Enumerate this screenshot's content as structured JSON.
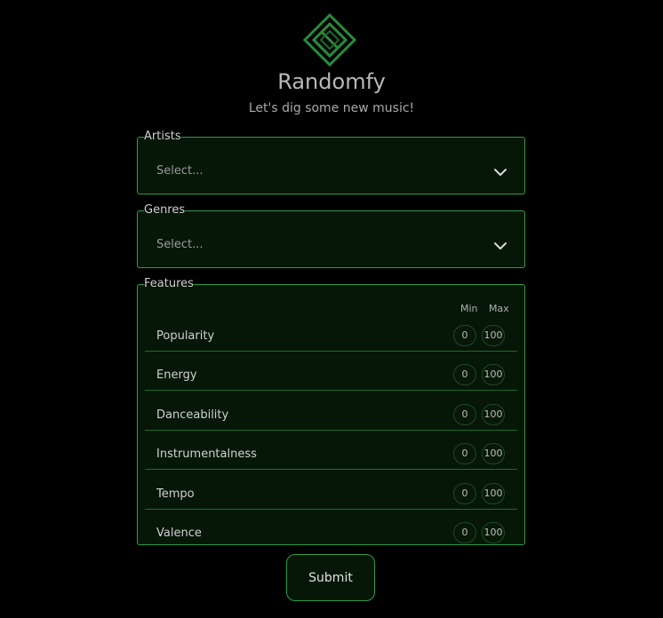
{
  "app": {
    "title": "Randomfy",
    "subtitle": "Let's dig some new music!",
    "logo_icon": "diamond-logo-icon",
    "accent_color": "#2f9a44"
  },
  "artists": {
    "legend": "Artists",
    "placeholder": "Select...",
    "icon": "chevron-down-icon"
  },
  "genres": {
    "legend": "Genres",
    "placeholder": "Select...",
    "icon": "chevron-down-icon"
  },
  "features": {
    "legend": "Features",
    "min_label": "Min",
    "max_label": "Max",
    "rows": [
      {
        "label": "Popularity",
        "min": "0",
        "max": "100"
      },
      {
        "label": "Energy",
        "min": "0",
        "max": "100"
      },
      {
        "label": "Danceability",
        "min": "0",
        "max": "100"
      },
      {
        "label": "Instrumentalness",
        "min": "0",
        "max": "100"
      },
      {
        "label": "Tempo",
        "min": "0",
        "max": "100"
      },
      {
        "label": "Valence",
        "min": "0",
        "max": "100"
      }
    ]
  },
  "submit": {
    "label": "Submit"
  }
}
